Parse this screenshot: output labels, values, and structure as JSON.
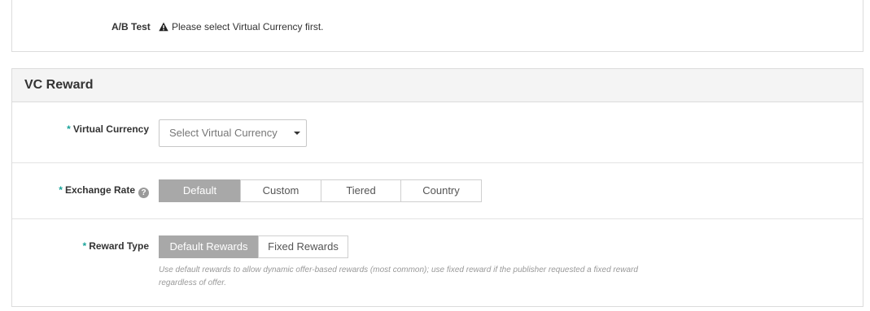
{
  "ab_test": {
    "label": "A/B Test",
    "warning": "Please select Virtual Currency first."
  },
  "vc_reward": {
    "title": "VC Reward",
    "virtual_currency": {
      "label": "Virtual Currency",
      "placeholder": "Select Virtual Currency"
    },
    "exchange_rate": {
      "label": "Exchange Rate",
      "options": [
        "Default",
        "Custom",
        "Tiered",
        "Country"
      ],
      "selected": "Default"
    },
    "reward_type": {
      "label": "Reward Type",
      "options": [
        "Default Rewards",
        "Fixed Rewards"
      ],
      "selected": "Default Rewards",
      "hint": "Use default rewards to allow dynamic offer-based rewards (most common); use fixed reward if the publisher requested a fixed reward regardless of offer."
    }
  },
  "required_marker": "*",
  "help_glyph": "?",
  "colors": {
    "required": "#1aa39a",
    "active_button": "#a8a8a8",
    "header_bg": "#f4f4f4"
  }
}
